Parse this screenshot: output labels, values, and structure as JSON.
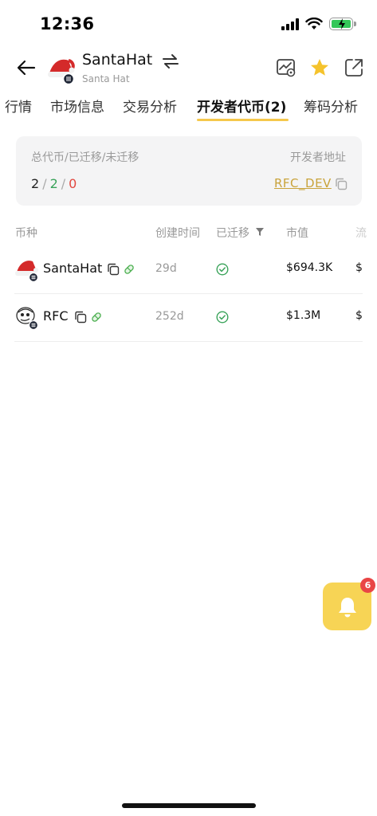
{
  "status_bar": {
    "time": "12:36",
    "icons": [
      "signal-icon",
      "wifi-icon",
      "battery-charging-icon"
    ],
    "battery_color": "#34c759"
  },
  "header": {
    "token_name": "SantaHat",
    "token_subtitle": "Santa Hat",
    "icons": [
      "back-arrow-icon",
      "swap-icon",
      "chart-watch-icon",
      "star-icon",
      "share-icon"
    ],
    "star_color": "#f5c32c"
  },
  "tabs": [
    {
      "label": "行情",
      "active": false
    },
    {
      "label": "市场信息",
      "active": false
    },
    {
      "label": "交易分析",
      "active": false
    },
    {
      "label": "开发者代币(2)",
      "active": true
    },
    {
      "label": "筹码分析",
      "active": false
    }
  ],
  "summary": {
    "label_left": "总代币/已迁移/未迁移",
    "label_right": "开发者地址",
    "total": "2",
    "separator": "/",
    "migrated": "2",
    "not_migrated": "0",
    "dev_address": "RFC_DEV",
    "colors": {
      "migrated": "#3aa35a",
      "not_migrated": "#e2473f",
      "link": "#c9a33b"
    }
  },
  "table": {
    "headers": {
      "coin": "币种",
      "created": "创建时间",
      "migrated": "已迁移",
      "mcap": "市值",
      "cut": "流"
    },
    "rows": [
      {
        "name": "SantaHat",
        "age": "29d",
        "migrated": true,
        "mcap": "$694.3K",
        "cut": "$"
      },
      {
        "name": "RFC",
        "age": "252d",
        "migrated": true,
        "mcap": "$1.3M",
        "cut": "$"
      }
    ]
  },
  "notification": {
    "badge_count": "6",
    "icon": "bell-icon",
    "button_color": "#f7d455"
  }
}
